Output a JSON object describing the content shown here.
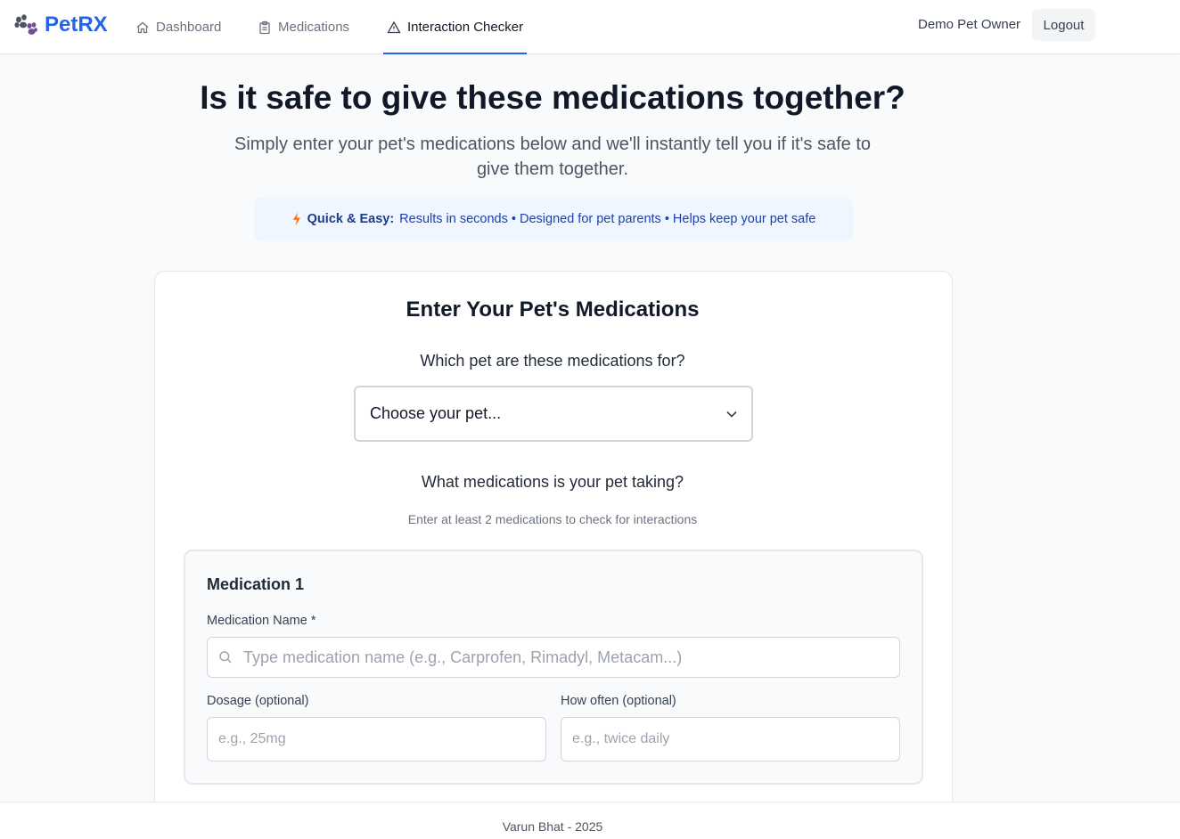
{
  "app": {
    "brand": "PetRX",
    "nav": [
      {
        "label": "Dashboard",
        "icon": "home-icon"
      },
      {
        "label": "Medications",
        "icon": "clipboard-icon"
      },
      {
        "label": "Interaction Checker",
        "icon": "alert-triangle-icon",
        "active": true
      }
    ],
    "user_name": "Demo Pet Owner",
    "logout_label": "Logout"
  },
  "hero": {
    "title": "Is it safe to give these medications together?",
    "subtitle": "Simply enter your pet's medications below and we'll instantly tell you if it's safe to give them together.",
    "quick_label": "Quick & Easy:",
    "quick_text": "Results in seconds • Designed for pet parents • Helps keep your pet safe"
  },
  "form": {
    "title": "Enter Your Pet's Medications",
    "pet_question": "Which pet are these medications for?",
    "pet_select_value": "Choose your pet...",
    "meds_question": "What medications is your pet taking?",
    "meds_hint": "Enter at least 2 medications to check for interactions",
    "medication": {
      "title": "Medication 1",
      "name_label": "Medication Name *",
      "name_placeholder": "Type medication name (e.g., Carprofen, Rimadyl, Metacam...)",
      "dosage_label": "Dosage (optional)",
      "dosage_placeholder": "e.g., 25mg",
      "frequency_label": "How often (optional)",
      "frequency_placeholder": "e.g., twice daily"
    }
  },
  "footer": {
    "text": "Varun Bhat - 2025"
  },
  "colors": {
    "brand": "#2563eb",
    "accent_bolt": "#f97316",
    "info_bg": "#eff6ff"
  }
}
